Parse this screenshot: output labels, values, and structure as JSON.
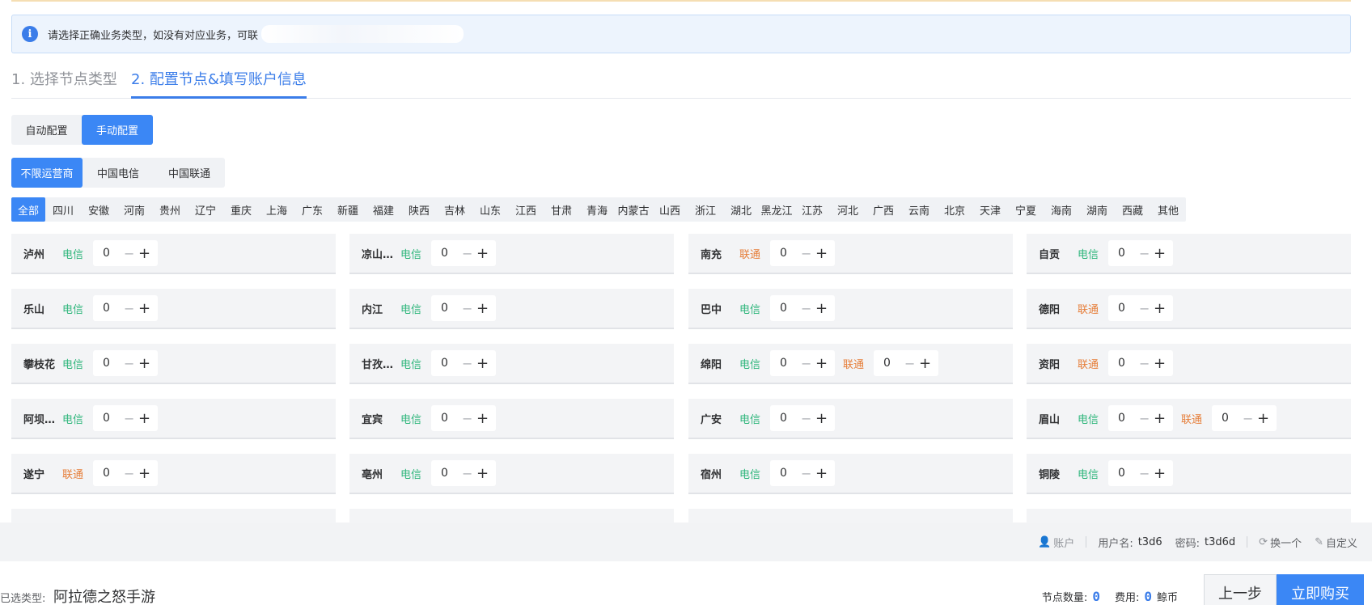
{
  "notice": {
    "text": "请选择正确业务类型，如没有对应业务，可联"
  },
  "steps": [
    {
      "label": "1. 选择节点类型"
    },
    {
      "label": "2. 配置节点&填写账户信息"
    }
  ],
  "config_mode": [
    {
      "label": "自动配置",
      "active": false
    },
    {
      "label": "手动配置",
      "active": true
    }
  ],
  "carrier_filter": [
    {
      "label": "不限运营商",
      "active": true
    },
    {
      "label": "中国电信",
      "active": false
    },
    {
      "label": "中国联通",
      "active": false
    }
  ],
  "provinces": [
    "全部",
    "四川",
    "安徽",
    "河南",
    "贵州",
    "辽宁",
    "重庆",
    "上海",
    "广东",
    "新疆",
    "福建",
    "陕西",
    "吉林",
    "山东",
    "江西",
    "甘肃",
    "青海",
    "内蒙古",
    "山西",
    "浙江",
    "湖北",
    "黑龙江",
    "江苏",
    "河北",
    "广西",
    "云南",
    "北京",
    "天津",
    "宁夏",
    "海南",
    "湖南",
    "西藏",
    "其他"
  ],
  "nodes": [
    {
      "city": "泸州",
      "lines": [
        {
          "carrier": "电信",
          "kind": "dx",
          "value": "0"
        }
      ]
    },
    {
      "city": "凉山…",
      "lines": [
        {
          "carrier": "电信",
          "kind": "dx",
          "value": "0"
        }
      ]
    },
    {
      "city": "南充",
      "lines": [
        {
          "carrier": "联通",
          "kind": "lt",
          "value": "0"
        }
      ]
    },
    {
      "city": "自贡",
      "lines": [
        {
          "carrier": "电信",
          "kind": "dx",
          "value": "0"
        }
      ]
    },
    {
      "city": "乐山",
      "lines": [
        {
          "carrier": "电信",
          "kind": "dx",
          "value": "0"
        }
      ]
    },
    {
      "city": "内江",
      "lines": [
        {
          "carrier": "电信",
          "kind": "dx",
          "value": "0"
        }
      ]
    },
    {
      "city": "巴中",
      "lines": [
        {
          "carrier": "电信",
          "kind": "dx",
          "value": "0"
        }
      ]
    },
    {
      "city": "德阳",
      "lines": [
        {
          "carrier": "联通",
          "kind": "lt",
          "value": "0"
        }
      ]
    },
    {
      "city": "攀枝花",
      "lines": [
        {
          "carrier": "电信",
          "kind": "dx",
          "value": "0"
        }
      ]
    },
    {
      "city": "甘孜…",
      "lines": [
        {
          "carrier": "电信",
          "kind": "dx",
          "value": "0"
        }
      ]
    },
    {
      "city": "绵阳",
      "lines": [
        {
          "carrier": "电信",
          "kind": "dx",
          "value": "0"
        },
        {
          "carrier": "联通",
          "kind": "lt",
          "value": "0"
        }
      ]
    },
    {
      "city": "资阳",
      "lines": [
        {
          "carrier": "联通",
          "kind": "lt",
          "value": "0"
        }
      ]
    },
    {
      "city": "阿坝…",
      "lines": [
        {
          "carrier": "电信",
          "kind": "dx",
          "value": "0"
        }
      ]
    },
    {
      "city": "宜宾",
      "lines": [
        {
          "carrier": "电信",
          "kind": "dx",
          "value": "0"
        }
      ]
    },
    {
      "city": "广安",
      "lines": [
        {
          "carrier": "电信",
          "kind": "dx",
          "value": "0"
        }
      ]
    },
    {
      "city": "眉山",
      "lines": [
        {
          "carrier": "电信",
          "kind": "dx",
          "value": "0"
        },
        {
          "carrier": "联通",
          "kind": "lt",
          "value": "0"
        }
      ]
    },
    {
      "city": "遂宁",
      "lines": [
        {
          "carrier": "联通",
          "kind": "lt",
          "value": "0"
        }
      ]
    },
    {
      "city": "亳州",
      "lines": [
        {
          "carrier": "电信",
          "kind": "dx",
          "value": "0"
        }
      ]
    },
    {
      "city": "宿州",
      "lines": [
        {
          "carrier": "电信",
          "kind": "dx",
          "value": "0"
        }
      ]
    },
    {
      "city": "铜陵",
      "lines": [
        {
          "carrier": "电信",
          "kind": "dx",
          "value": "0"
        }
      ]
    }
  ],
  "stepper": {
    "minus": "−",
    "plus": "+"
  },
  "account_bar": {
    "account_label": "账户",
    "username_label": "用户名:",
    "username": "t3d6",
    "password_label": "密码:",
    "password": "t3d6d",
    "change_label": "换一个",
    "custom_label": "自定义"
  },
  "bottom": {
    "selected_label": "已选类型:",
    "selected_value": "阿拉德之怒手游",
    "node_count_label": "节点数量:",
    "node_count": "0",
    "fee_label": "费用:",
    "fee": "0",
    "currency": "鲸币",
    "prev_label": "上一步",
    "buy_label": "立即购买"
  },
  "colors": {
    "primary": "#3b87f5",
    "telecom": "#2fb67c",
    "unicom": "#e67e3a"
  }
}
